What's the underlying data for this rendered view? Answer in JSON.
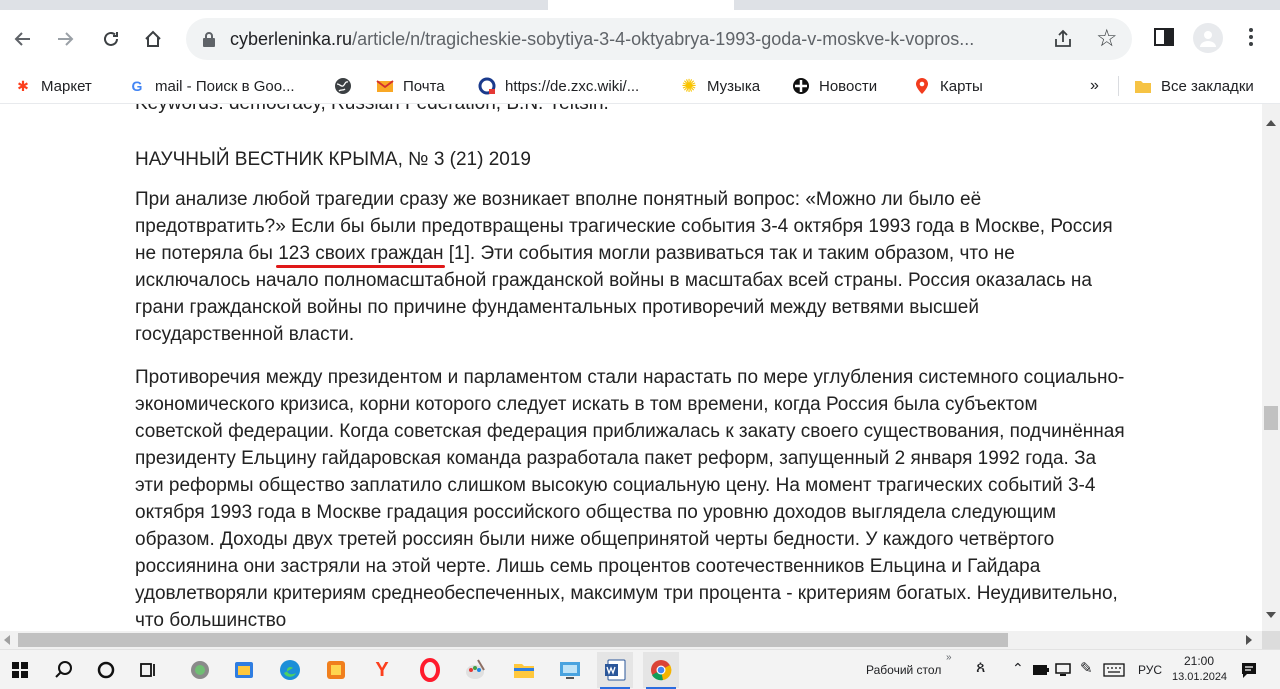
{
  "browser": {
    "url_host": "cyberleninka.ru",
    "url_path": "/article/n/tragicheskie-sobytiya-3-4-oktyabrya-1993-goda-v-moskve-k-vopros...",
    "bookmarks": [
      {
        "label": "Маркет",
        "icon": "yandex-market-icon",
        "color": "#fc3f1d"
      },
      {
        "label": "mail - Поиск в Goo...",
        "icon": "google-icon",
        "color": "#4285f4"
      },
      {
        "label": "",
        "icon": "globe-icon",
        "color": "#3c4043"
      },
      {
        "label": "Почта",
        "icon": "mail-icon",
        "color": "#f9a825"
      },
      {
        "label": "https://de.zxc.wiki/...",
        "icon": "wiki-icon",
        "color": "#1a3a8c"
      },
      {
        "label": "Музыка",
        "icon": "music-icon",
        "color": "#f9c400"
      },
      {
        "label": "Новости",
        "icon": "news-icon",
        "color": "#111111"
      },
      {
        "label": "Карты",
        "icon": "maps-icon",
        "color": "#f23c1e"
      }
    ],
    "bookmarks_overflow": "»",
    "all_bookmarks": "Все закладки"
  },
  "article": {
    "keywords": "Keywords: democracy, Russian Federation, B.N. Yeltsin.",
    "journal": "НАУЧНЫЙ ВЕСТНИК КРЫМА, № 3 (21) 2019",
    "p1_before": "При анализе любой трагедии сразу же возникает вполне понятный вопрос: «Можно ли было её предотвратить?» Если бы были предотвращены трагические события 3-4 октября 1993 года в Москве, Россия не потеряла бы ",
    "p1_highlight": "123 своих граждан",
    "p1_after": " [1]. Эти события могли развиваться так и таким образом, что не исключалось начало полномасштабной гражданской войны в масштабах всей страны. Россия оказалась на грани гражданской войны по причине фундаментальных противоречий между ветвями высшей государственной власти.",
    "p2": "Противоречия между президентом и парламентом стали нарастать по мере углубления системного социально-экономического кризиса, корни которого следует искать в том времени, когда Россия была субъектом советской федерации. Когда советская федерация приближалась к закату своего существования, подчинённая президенту Ельцину гайдаровская команда разработала пакет реформ, запущенный 2 января 1992 года. За эти реформы общество заплатило слишком высокую социальную цену. На момент трагических событий 3-4 октября 1993 года в Москве градация российского общества по уровню доходов выглядела следующим образом. Доходы двух третей россиян были ниже общепринятой черты бедности. У каждого четвёртого россиянина они застряли на этой черте. Лишь семь процентов соотечественников Ельцина и Гайдара удовлетворяли критериям среднеобеспеченных, максимум три процента - критериям богатых. Неудивительно, что большинство"
  },
  "taskbar": {
    "desktop_label": "Рабочий стол",
    "language": "РУС",
    "time": "21:00",
    "date": "13.01.2024"
  }
}
